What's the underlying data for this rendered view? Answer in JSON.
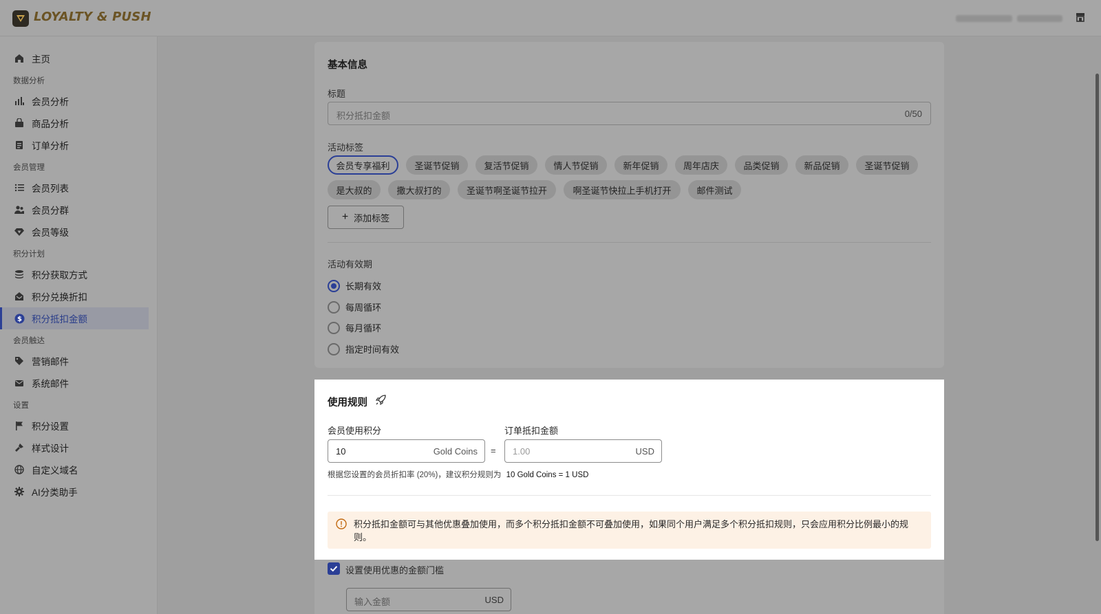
{
  "header": {
    "brand": "LOYALTY & PUSH",
    "store_icon": "store-icon"
  },
  "sidebar": {
    "home": "主页",
    "groups": {
      "data_analysis": "数据分析",
      "member_mgmt": "会员管理",
      "points_plan": "积分计划",
      "member_reach": "会员触达",
      "settings": "设置"
    },
    "items": {
      "member_analysis": "会员分析",
      "product_analysis": "商品分析",
      "order_analysis": "订单分析",
      "member_list": "会员列表",
      "member_segments": "会员分群",
      "member_levels": "会员等级",
      "points_earn": "积分获取方式",
      "points_redeem_discount": "积分兑换折扣",
      "points_deduct_amount": "积分抵扣金额",
      "marketing_email": "营销邮件",
      "system_email": "系统邮件",
      "points_settings": "积分设置",
      "style_design": "样式设计",
      "custom_domain": "自定义域名",
      "ai_assistant": "AI分类助手"
    },
    "active": "points_deduct_amount"
  },
  "basic": {
    "section_title": "基本信息",
    "title_label": "标题",
    "title_placeholder": "积分抵扣金额",
    "title_counter": "0/50",
    "tags_label": "活动标签",
    "tags": [
      "会员专享福利",
      "圣诞节促销",
      "复活节促销",
      "情人节促销",
      "新年促销",
      "周年店庆",
      "品类促销",
      "新品促销",
      "圣诞节促销",
      "是大叔的",
      "撒大叔打的",
      "圣诞节啊圣诞节拉开",
      "啊圣诞节快拉上手机打开",
      "邮件测试"
    ],
    "selected_tag": "会员专享福利",
    "add_tag": "添加标签",
    "validity_label": "活动有效期",
    "validity_options": [
      "长期有效",
      "每周循环",
      "每月循环",
      "指定时间有效"
    ],
    "validity_selected": "长期有效"
  },
  "rules": {
    "section_title": "使用规则",
    "points_label": "会员使用积分",
    "points_value": "10",
    "points_unit": "Gold Coins",
    "equals": "=",
    "amount_label": "订单抵扣金额",
    "amount_placeholder": "1.00",
    "amount_unit": "USD",
    "hint_prefix": "根据您设置的会员折扣率 (20%)，建议积分规则为",
    "hint_rule": "10 Gold Coins = 1 USD",
    "alert_text": "积分抵扣金额可与其他优惠叠加使用，而多个积分抵扣金额不可叠加使用，如果同个用户满足多个积分抵扣规则，只会应用积分比例最小的规则。",
    "threshold_label": "设置使用优惠的金额门槛",
    "threshold_checked": true,
    "threshold_placeholder": "输入金额",
    "threshold_unit": "USD"
  }
}
